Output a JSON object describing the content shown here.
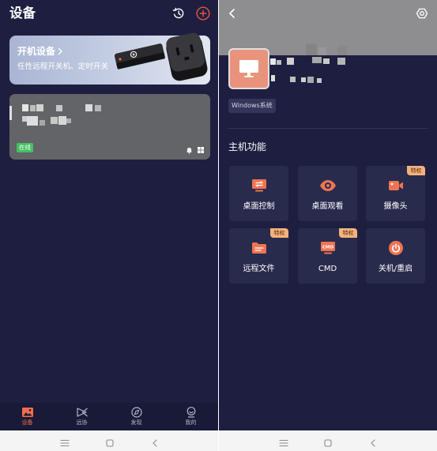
{
  "left": {
    "header": {
      "title": "设备",
      "history_icon": "history-icon",
      "add_icon": "add-circle-icon"
    },
    "banner": {
      "title": "开机设备",
      "subtitle": "任性远程开关机、定时开关",
      "arrow_icon": "chevron-right-icon"
    },
    "device_card": {
      "status": "在线",
      "icons": [
        "bell-icon",
        "windows-icon"
      ]
    },
    "tabs": [
      {
        "label": "设备",
        "icon": "picture-icon",
        "active": true
      },
      {
        "label": "远协",
        "icon": "remote-assist-icon",
        "active": false
      },
      {
        "label": "发现",
        "icon": "compass-icon",
        "active": false
      },
      {
        "label": "我的",
        "icon": "profile-icon",
        "active": false
      }
    ]
  },
  "right": {
    "header": {
      "back_icon": "chevron-left-icon",
      "settings_icon": "gear-icon"
    },
    "avatar_icon": "monitor-icon",
    "os_tag": "Windows系统",
    "section_title": "主机功能",
    "functions": [
      {
        "label": "桌面控制",
        "icon": "desktop-control-icon"
      },
      {
        "label": "桌面观看",
        "icon": "eye-icon"
      },
      {
        "label": "摄像头",
        "icon": "camera-icon",
        "badge": "特权"
      },
      {
        "label": "远程文件",
        "icon": "folder-icon",
        "badge": "特权"
      },
      {
        "label": "CMD",
        "icon": "cmd-icon",
        "badge": "特权",
        "icon_text": "CMD"
      },
      {
        "label": "关机/重启",
        "icon": "power-icon"
      }
    ]
  },
  "system_nav": {
    "icons": [
      "menu-icon",
      "home-icon",
      "back-icon"
    ]
  },
  "colors": {
    "background": "#1e1f40",
    "card": "#292b4d",
    "accent": "#ef7452",
    "badge": "#f3b27c",
    "online": "#43c064",
    "add_button": "#e9553d"
  }
}
